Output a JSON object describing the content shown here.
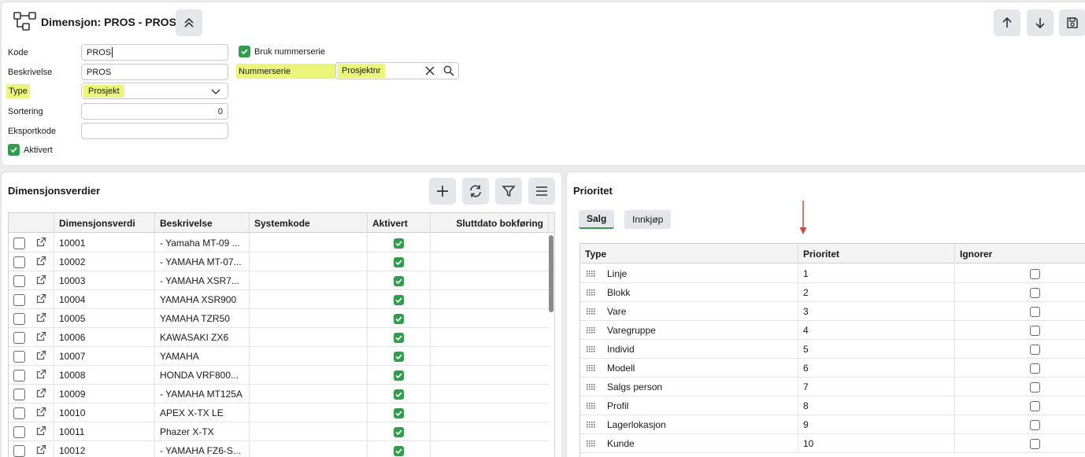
{
  "header": {
    "title": "Dimensjon: PROS - PROS"
  },
  "form": {
    "kode_label": "Kode",
    "kode_value": "PROS",
    "beskrivelse_label": "Beskrivelse",
    "beskrivelse_value": "PROS",
    "type_label": "Type",
    "type_value": "Prosjekt",
    "sortering_label": "Sortering",
    "sortering_value": "0",
    "eksportkode_label": "Eksportkode",
    "eksportkode_value": "",
    "aktivert_label": "Aktivert",
    "bruk_nummerserie_label": "Bruk nummerserie",
    "nummerserie_label": "Nummerserie",
    "nummerserie_value": "Prosjektnr"
  },
  "dimensjonsverdier": {
    "title": "Dimensjonsverdier",
    "columns": [
      "Dimensjonsverdi",
      "Beskrivelse",
      "Systemkode",
      "Aktivert",
      "Sluttdato bokføring"
    ],
    "rows": [
      {
        "verdi": "10001",
        "beskrivelse": "- Yamaha MT-09 ...",
        "systemkode": "",
        "aktivert": true
      },
      {
        "verdi": "10002",
        "beskrivelse": "- YAMAHA MT-07...",
        "systemkode": "",
        "aktivert": true
      },
      {
        "verdi": "10003",
        "beskrivelse": "- YAMAHA XSR7...",
        "systemkode": "",
        "aktivert": true
      },
      {
        "verdi": "10004",
        "beskrivelse": "YAMAHA XSR900",
        "systemkode": "",
        "aktivert": true
      },
      {
        "verdi": "10005",
        "beskrivelse": "YAMAHA TZR50",
        "systemkode": "",
        "aktivert": true
      },
      {
        "verdi": "10006",
        "beskrivelse": "KAWASAKI ZX6",
        "systemkode": "",
        "aktivert": true
      },
      {
        "verdi": "10007",
        "beskrivelse": "YAMAHA",
        "systemkode": "",
        "aktivert": true
      },
      {
        "verdi": "10008",
        "beskrivelse": "HONDA VRF800...",
        "systemkode": "",
        "aktivert": true
      },
      {
        "verdi": "10009",
        "beskrivelse": "- YAMAHA MT125A",
        "systemkode": "",
        "aktivert": true
      },
      {
        "verdi": "10010",
        "beskrivelse": "APEX X-TX LE",
        "systemkode": "",
        "aktivert": true
      },
      {
        "verdi": "10011",
        "beskrivelse": "Phazer X-TX",
        "systemkode": "",
        "aktivert": true
      },
      {
        "verdi": "10012",
        "beskrivelse": "- YAMAHA FZ6-S...",
        "systemkode": "",
        "aktivert": true
      }
    ]
  },
  "prioritet": {
    "title": "Prioritet",
    "tabs": [
      "Salg",
      "Innkjøp"
    ],
    "active_tab": "Salg",
    "columns": [
      "Type",
      "Prioritet",
      "Ignorer"
    ],
    "rows": [
      {
        "type": "Linje",
        "prioritet": "1",
        "ignorer": false
      },
      {
        "type": "Blokk",
        "prioritet": "2",
        "ignorer": false
      },
      {
        "type": "Vare",
        "prioritet": "3",
        "ignorer": false
      },
      {
        "type": "Varegruppe",
        "prioritet": "4",
        "ignorer": false
      },
      {
        "type": "Individ",
        "prioritet": "5",
        "ignorer": false
      },
      {
        "type": "Modell",
        "prioritet": "6",
        "ignorer": false
      },
      {
        "type": "Salgs person",
        "prioritet": "7",
        "ignorer": false
      },
      {
        "type": "Profil",
        "prioritet": "8",
        "ignorer": false
      },
      {
        "type": "Lagerlokasjon",
        "prioritet": "9",
        "ignorer": false
      },
      {
        "type": "Kunde",
        "prioritet": "10",
        "ignorer": false
      }
    ]
  },
  "colors": {
    "highlight": "#eaf57a",
    "check_green": "#2e9e4a",
    "annotation_arrow": "#e0443a"
  }
}
